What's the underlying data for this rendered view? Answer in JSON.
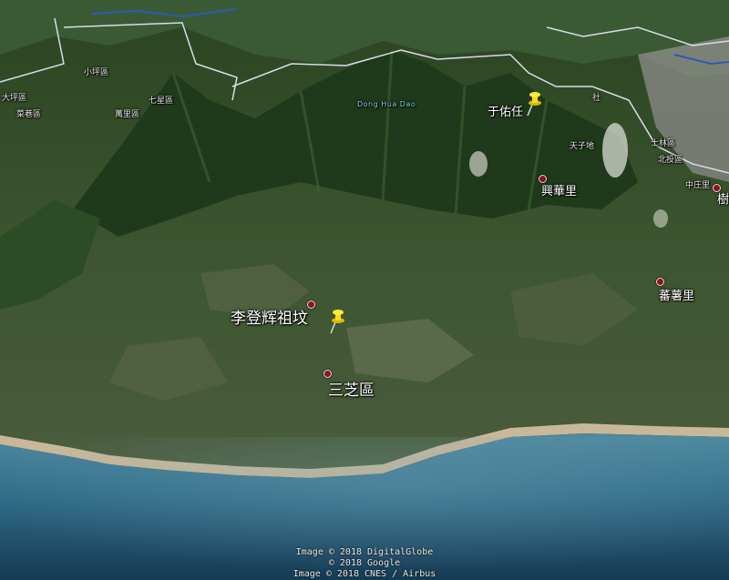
{
  "map": {
    "places": {
      "lee_tomb": "李登辉祖坟",
      "sanzhi": "三芝區",
      "yu_you_ren": "于佑任",
      "xinghua": "興華里",
      "fanshu": "蕃薯里",
      "tianzi": "天子地",
      "shilin": "士林區",
      "beitou": "北投區",
      "zhongzhuang": "中庄里",
      "shu": "樹",
      "upper_left_1": "小坪區",
      "upper_left_2": "菜巷區",
      "upper_left_3": "萬里區",
      "upper_left_4": "七星區",
      "upper_left_5": "大坪區",
      "upper_right_edge": "社",
      "water_label": "Dong Hua Dao"
    },
    "attribution": [
      "Image © 2018 DigitalGlobe",
      "© 2018 Google",
      "Image © 2018 CNES / Airbus"
    ]
  }
}
